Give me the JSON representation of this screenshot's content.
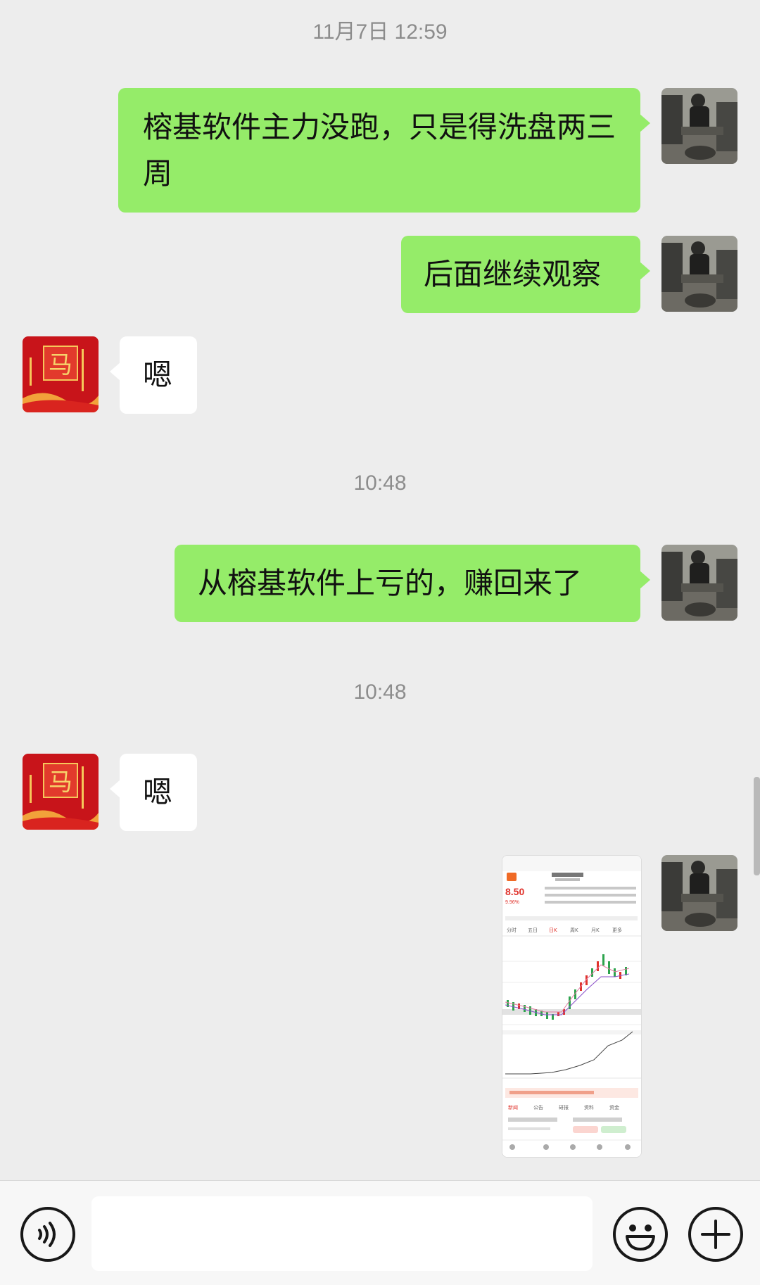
{
  "messages": {
    "t1": "11月7日 12:59",
    "m1": "榕基软件主力没跑，只是得洗盘两三周",
    "m2": "后面继续观察",
    "m3": "嗯",
    "t2": "10:48",
    "m4": "从榕基软件上亏的，赚回来了",
    "t3": "10:48",
    "m5": "嗯"
  },
  "other_avatar": {
    "logo_text": "马"
  },
  "stock_screenshot": {
    "price": "8.50",
    "change": "9.96%",
    "tabs": [
      "分时",
      "五日",
      "日K",
      "周K",
      "月K",
      "更多"
    ],
    "bottom_tabs": [
      "新闻",
      "公告",
      "研报",
      "资料",
      "资金"
    ]
  },
  "icons": {
    "voice": "voice-icon",
    "emoji": "emoji-icon",
    "plus": "plus-icon"
  },
  "colors": {
    "background": "#ededed",
    "my_bubble": "#95ec69",
    "other_bubble": "#ffffff",
    "timestamp": "#8c8c8c"
  }
}
